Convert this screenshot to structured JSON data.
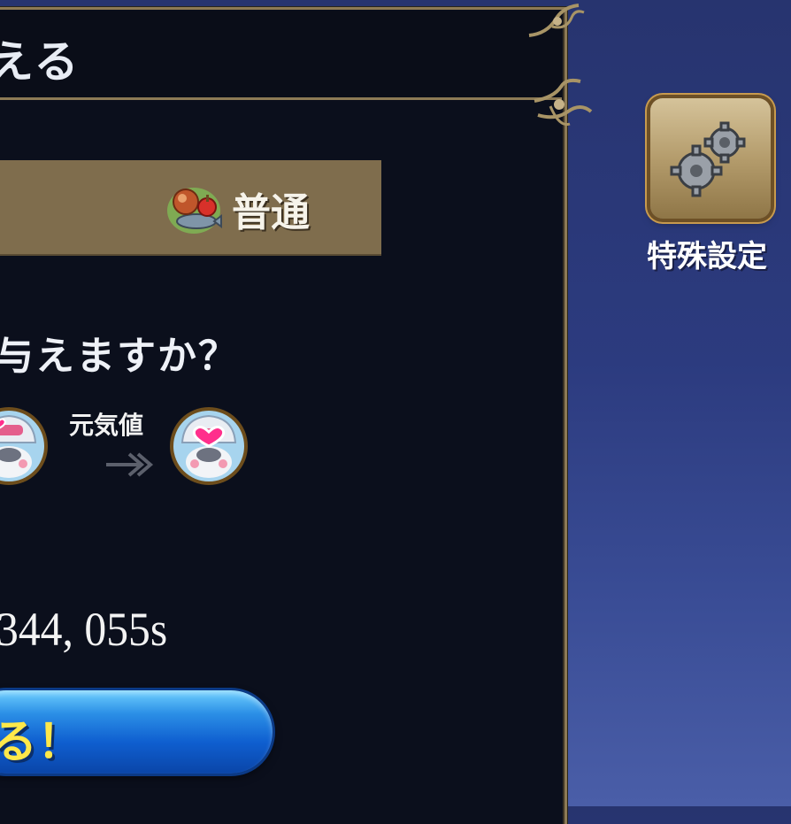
{
  "dialog": {
    "title": "える",
    "category_label": "普通",
    "question": "与えますか？",
    "stat_label": "元気値",
    "value": "344, 055s",
    "confirm_label": "る！"
  },
  "side": {
    "settings_label": "特殊設定"
  },
  "icons": {
    "category": "food-meat-fish-icon",
    "settings": "gears-icon",
    "avatar": "bunny-mask-heart-icon",
    "arrow": "double-chevron-right-icon"
  },
  "colors": {
    "panel_bg": "#0b0f1c",
    "panel_border": "#8d7a55",
    "category_bar": "#7f6d4d",
    "confirm_button": "#1e6fe0",
    "confirm_text": "#ffe84a",
    "background": "#2c3b7f"
  }
}
